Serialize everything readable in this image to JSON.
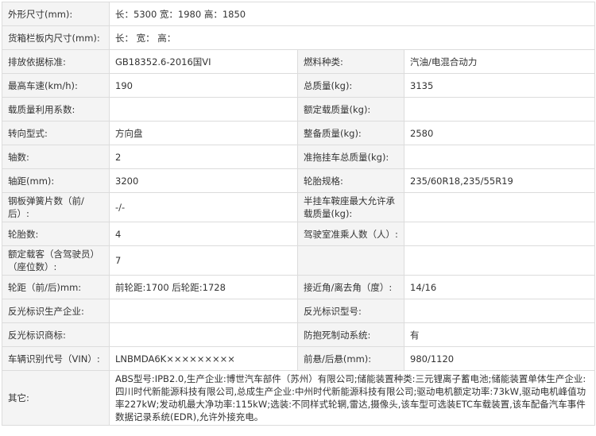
{
  "rows": [
    {
      "l1": "外形尺寸(mm):",
      "v1": "长：5300 宽：1980 高：1850"
    },
    {
      "l1": "货箱栏板内尺寸(mm):",
      "v1": "长： 宽： 高："
    },
    {
      "l1": "排放依据标准:",
      "v1": "GB18352.6-2016国VI",
      "l2": "燃料种类:",
      "v2": "汽油/电混合动力"
    },
    {
      "l1": "最高车速(km/h):",
      "v1": "190",
      "l2": "总质量(kg):",
      "v2": "3135"
    },
    {
      "l1": "载质量利用系数:",
      "v1": "",
      "l2": "额定载质量(kg):",
      "v2": ""
    },
    {
      "l1": "转向型式:",
      "v1": "方向盘",
      "l2": "整备质量(kg):",
      "v2": "2580"
    },
    {
      "l1": "轴数:",
      "v1": "2",
      "l2": "准拖挂车总质量(kg):",
      "v2": ""
    },
    {
      "l1": "轴距(mm):",
      "v1": "3200",
      "l2": "轮胎规格:",
      "v2": "235/60R18,235/55R19"
    },
    {
      "l1": "钢板弹簧片数（前/后）:",
      "v1": "-/-",
      "l2": "半挂车鞍座最大允许承载质量(kg):",
      "v2": ""
    },
    {
      "l1": "轮胎数:",
      "v1": "4",
      "l2": "驾驶室准乘人数（人）:",
      "v2": ""
    },
    {
      "l1": "额定载客（含驾驶员）（座位数）:",
      "v1": "7",
      "l2": "",
      "v2": ""
    },
    {
      "l1": "轮距（前/后)mm:",
      "v1": "前轮距:1700 后轮距:1728",
      "l2": "接近角/离去角（度）:",
      "v2": "14/16"
    },
    {
      "l1": "反光标识生产企业:",
      "v1": "",
      "l2": "反光标识型号:",
      "v2": ""
    },
    {
      "l1": "反光标识商标:",
      "v1": "",
      "l2": "防抱死制动系统:",
      "v2": "有"
    },
    {
      "l1": "车辆识别代号（VIN）:",
      "v1": "LNBMDA6K×××××××××",
      "l2": "前悬/后悬(mm):",
      "v2": "980/1120"
    }
  ],
  "other": {
    "label": "其它:",
    "text": "ABS型号:IPB2.0,生产企业:博世汽车部件（苏州）有限公司;储能装置种类:三元锂离子蓄电池;储能装置单体生产企业:四川时代新能源科技有限公司,总成生产企业:中州时代新能源科技有限公司;驱动电机额定功率:73kW,驱动电机峰值功率227kW;发动机最大净功率:115kW;选装:不同样式轮辋,雷达,摄像头,该车型可选装ETC车载装置,该车配备汽车事件数据记录系统(EDR),允许外接充电。"
  }
}
